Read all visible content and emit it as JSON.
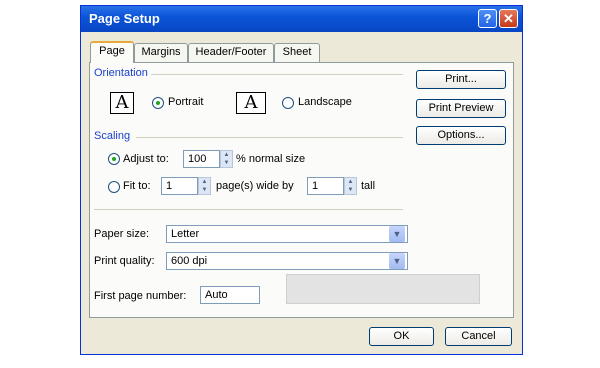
{
  "window": {
    "title": "Page Setup",
    "help_glyph": "?",
    "close_glyph": "✕"
  },
  "tabs": [
    {
      "label": "Page",
      "active": true
    },
    {
      "label": "Margins",
      "active": false
    },
    {
      "label": "Header/Footer",
      "active": false
    },
    {
      "label": "Sheet",
      "active": false
    }
  ],
  "orientation": {
    "group_label": "Orientation",
    "portrait_label": "Portrait",
    "landscape_label": "Landscape",
    "selected": "portrait",
    "icon_glyph": "A"
  },
  "scaling": {
    "group_label": "Scaling",
    "adjust_label": "Adjust to:",
    "adjust_value": "100",
    "adjust_suffix": "% normal size",
    "fit_label": "Fit to:",
    "fit_wide_value": "1",
    "fit_wide_suffix": "page(s) wide by",
    "fit_tall_value": "1",
    "fit_tall_suffix": "tall",
    "selected": "adjust"
  },
  "paper_size": {
    "label": "Paper size:",
    "value": "Letter"
  },
  "print_quality": {
    "label": "Print quality:",
    "value": "600 dpi"
  },
  "first_page_number": {
    "label": "First page number:",
    "value": "Auto"
  },
  "side_buttons": {
    "print": "Print...",
    "print_preview": "Print Preview",
    "options": "Options..."
  },
  "footer": {
    "ok": "OK",
    "cancel": "Cancel"
  },
  "colors": {
    "titlebar": "#0b55d8",
    "group_label": "#1a40c8",
    "dialog_bg": "#ece9d8"
  }
}
